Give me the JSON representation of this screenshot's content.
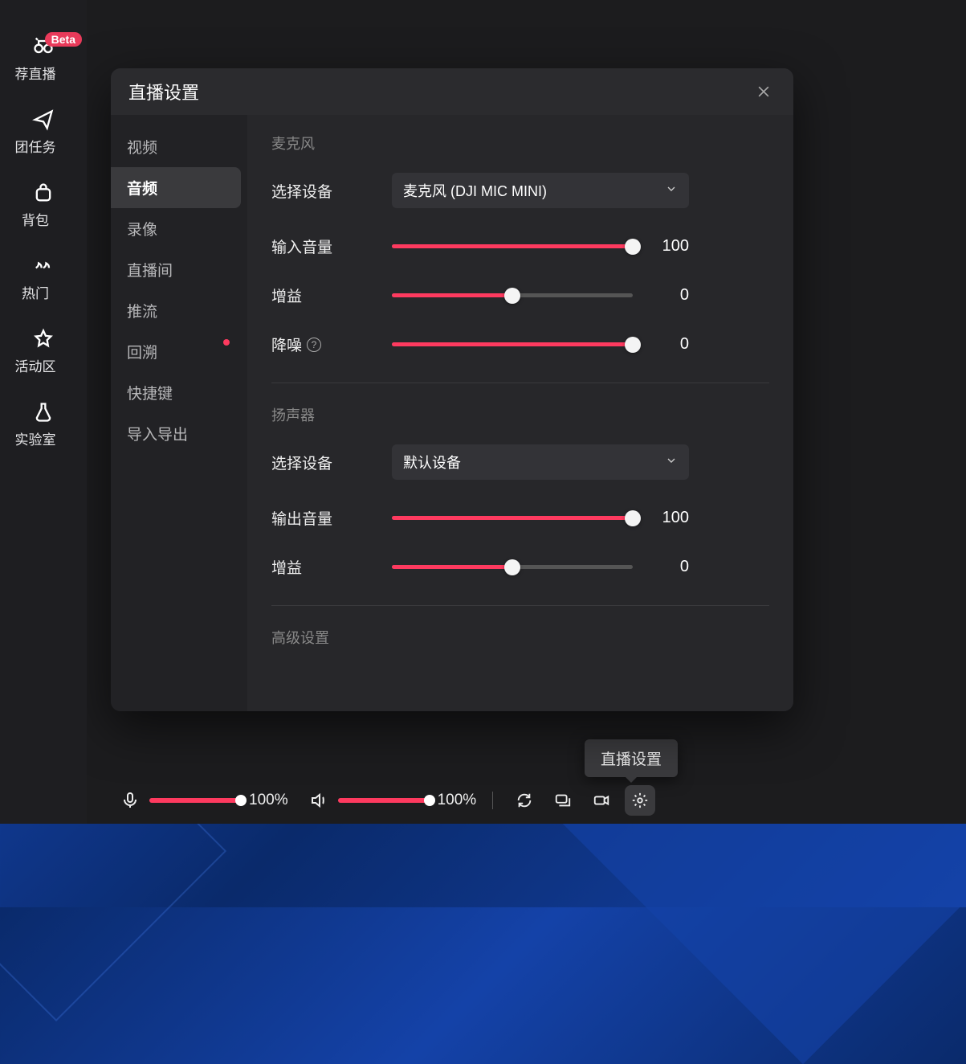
{
  "left_sidebar": {
    "items": [
      {
        "label": "荐直播",
        "badge": "Beta"
      },
      {
        "label": "团任务"
      },
      {
        "label": "背包"
      },
      {
        "label": "热门"
      },
      {
        "label": "活动区"
      },
      {
        "label": "实验室"
      }
    ]
  },
  "dialog": {
    "title": "直播设置",
    "tabs": [
      {
        "label": "视频"
      },
      {
        "label": "音频",
        "active": true
      },
      {
        "label": "录像"
      },
      {
        "label": "直播间"
      },
      {
        "label": "推流"
      },
      {
        "label": "回溯",
        "dot": true
      },
      {
        "label": "快捷键"
      },
      {
        "label": "导入导出"
      }
    ],
    "sections": {
      "mic": {
        "title": "麦克风",
        "device_label": "选择设备",
        "device_value": "麦克风 (DJI MIC MINI)",
        "input_volume_label": "输入音量",
        "input_volume_value": "100",
        "input_volume_pct": 100,
        "gain_label": "增益",
        "gain_value": "0",
        "gain_pct": 50,
        "noise_label": "降噪",
        "noise_value": "0",
        "noise_pct": 100
      },
      "speaker": {
        "title": "扬声器",
        "device_label": "选择设备",
        "device_value": "默认设备",
        "output_volume_label": "输出音量",
        "output_volume_value": "100",
        "output_volume_pct": 100,
        "gain_label": "增益",
        "gain_value": "0",
        "gain_pct": 50
      },
      "advanced": {
        "title": "高级设置"
      }
    }
  },
  "bottom_bar": {
    "mic_pct": "100%",
    "mic_fill": 100,
    "spk_pct": "100%",
    "spk_fill": 100
  },
  "tooltip": "直播设置"
}
